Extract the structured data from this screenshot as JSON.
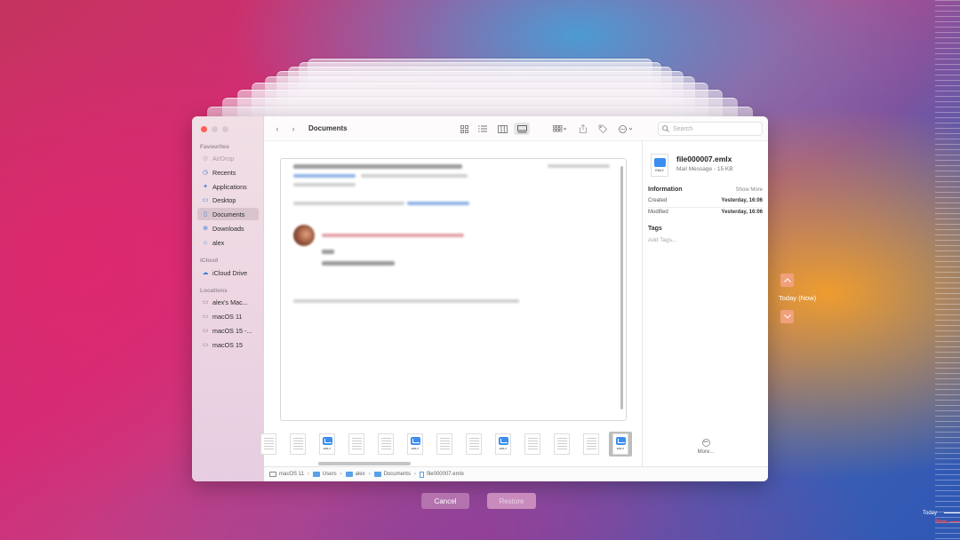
{
  "finder": {
    "title": "Documents",
    "search_placeholder": "Search",
    "sidebar": {
      "favourites_label": "Favourites",
      "favourites": [
        {
          "label": "AirDrop",
          "icon": "airdrop-icon"
        },
        {
          "label": "Recents",
          "icon": "clock-icon"
        },
        {
          "label": "Applications",
          "icon": "applications-icon"
        },
        {
          "label": "Desktop",
          "icon": "desktop-icon"
        },
        {
          "label": "Documents",
          "icon": "document-icon"
        },
        {
          "label": "Downloads",
          "icon": "download-icon"
        },
        {
          "label": "alex",
          "icon": "home-icon"
        }
      ],
      "icloud_label": "iCloud",
      "icloud": [
        {
          "label": "iCloud Drive",
          "icon": "cloud-icon"
        }
      ],
      "locations_label": "Locations",
      "locations": [
        {
          "label": "alex's Mac...",
          "icon": "laptop-icon"
        },
        {
          "label": "macOS 11",
          "icon": "disk-icon"
        },
        {
          "label": "macOS 15 -...",
          "icon": "disk-icon"
        },
        {
          "label": "macOS 15",
          "icon": "disk-icon"
        }
      ]
    },
    "inspector": {
      "file_name": "file000007.emlx",
      "file_subtitle": "Mail Message - 15 KB",
      "icon_label": "EMLX",
      "information_label": "Information",
      "show_more": "Show More",
      "created_label": "Created",
      "created_value": "Yesterday, 16:06",
      "modified_label": "Modified",
      "modified_value": "Yesterday, 16:06",
      "tags_label": "Tags",
      "add_tags": "Add Tags...",
      "more_label": "More..."
    },
    "pathbar": {
      "items": [
        "macOS 11",
        "Users",
        "alex",
        "Documents",
        "file000007.emlx"
      ]
    },
    "filmstrip": {
      "types": [
        "doc",
        "doc",
        "emlx",
        "doc",
        "doc",
        "emlx",
        "doc",
        "doc",
        "emlx",
        "doc",
        "doc",
        "doc",
        "emlx"
      ],
      "selected_index": 12,
      "emlx_label": "EMLX"
    }
  },
  "time_machine": {
    "cancel_label": "Cancel",
    "restore_label": "Restore",
    "today_now_label": "Today (Now)",
    "timeline_today": "Today",
    "timeline_now": "Now"
  },
  "colors": {
    "traffic_close": "#ff5f57",
    "traffic_min": "#d5c9cf",
    "traffic_zoom": "#d5c9cf",
    "accent_blue": "#3b8ef0",
    "cancel_bg": "#b473ae",
    "restore_bg": "#c98bbd",
    "arrow_bg": "#f0a07a",
    "timeline_now": "#ff4a4a"
  }
}
